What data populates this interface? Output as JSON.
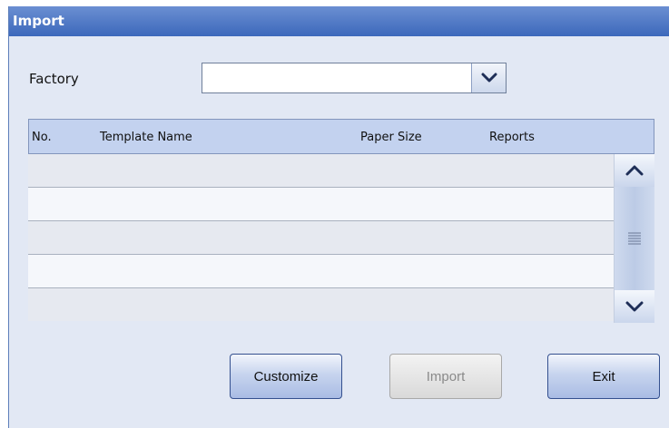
{
  "window": {
    "title": "Import"
  },
  "factory": {
    "label": "Factory",
    "value": ""
  },
  "table": {
    "columns": [
      "No.",
      "Template Name",
      "Paper Size",
      "Reports"
    ],
    "rows": [
      [
        "",
        "",
        "",
        ""
      ],
      [
        "",
        "",
        "",
        ""
      ],
      [
        "",
        "",
        "",
        ""
      ],
      [
        "",
        "",
        "",
        ""
      ],
      [
        "",
        "",
        "",
        ""
      ]
    ]
  },
  "buttons": {
    "customize": "Customize",
    "import": "Import",
    "exit": "Exit"
  },
  "icons": {
    "dropdown": "chevron-down-icon",
    "scroll_up": "chevron-up-icon",
    "scroll_thumb": "grip-lines-icon",
    "scroll_down": "chevron-down-icon"
  },
  "colors": {
    "title_bar": "#3c68bb",
    "dialog_background": "#e2e8f4",
    "header_background": "#c3d2ef",
    "disabled_text": "#8a8a8a"
  }
}
